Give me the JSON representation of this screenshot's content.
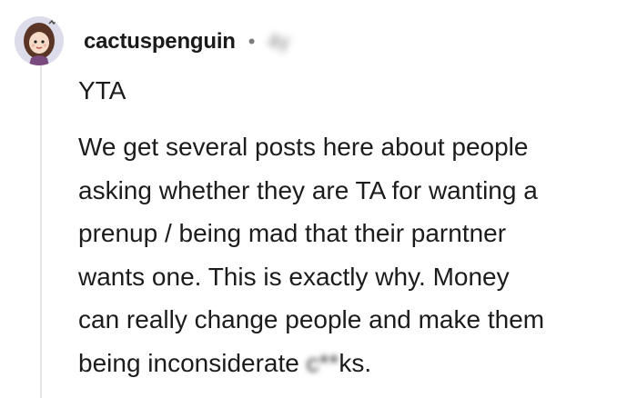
{
  "comment": {
    "author": "cactuspenguin",
    "separator": "•",
    "timestamp": "4y",
    "flair": "YTA",
    "body_lines": [
      "We get several posts here about people",
      "asking whether they are TA for wanting a",
      "prenup / being mad that their parntner",
      "wants one. This is exactly why. Money",
      "can really change people and make them"
    ],
    "last_line": {
      "before": "being inconsiderate ",
      "censored": "c**",
      "after": "ks."
    }
  }
}
